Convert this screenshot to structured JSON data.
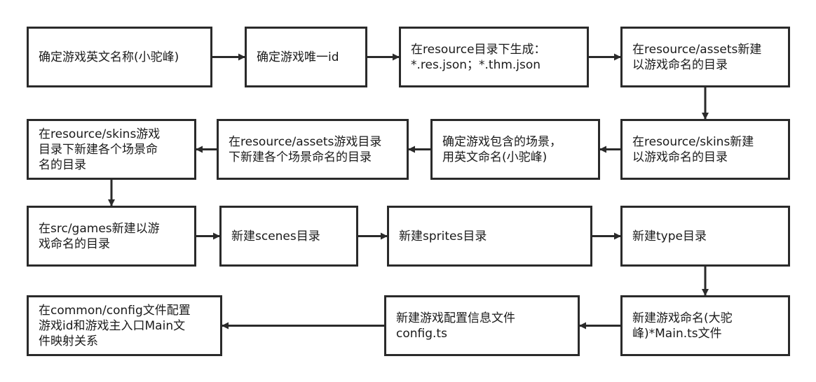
{
  "colors": {
    "stroke": "#2a2a2a",
    "text": "#1a1a1a",
    "background": "#ffffff"
  },
  "nodes": [
    {
      "id": "n1",
      "label": "确定游戏英文名称(小驼峰)"
    },
    {
      "id": "n2",
      "label": "确定游戏唯一id"
    },
    {
      "id": "n3",
      "label": "在resource目录下生成：\n*.res.json；*.thm.json"
    },
    {
      "id": "n4",
      "label": "在resource/assets新建\n以游戏命名的目录"
    },
    {
      "id": "n5",
      "label": "在resource/skins新建\n以游戏命名的目录"
    },
    {
      "id": "n6",
      "label": "确定游戏包含的场景，\n用英文命名(小驼峰)"
    },
    {
      "id": "n7",
      "label": "在resource/assets游戏目录\n下新建各个场景命名的目录"
    },
    {
      "id": "n8",
      "label": "在resource/skins游戏\n目录下新建各个场景命\n名的目录"
    },
    {
      "id": "n9",
      "label": "在src/games新建以游\n戏命名的目录"
    },
    {
      "id": "n10",
      "label": "新建scenes目录"
    },
    {
      "id": "n11",
      "label": "新建sprites目录"
    },
    {
      "id": "n12",
      "label": "新建type目录"
    },
    {
      "id": "n13",
      "label": "新建游戏命名(大驼\n峰)*Main.ts文件"
    },
    {
      "id": "n14",
      "label": "新建游戏配置信息文件\nconfig.ts"
    },
    {
      "id": "n15",
      "label": "在common/config文件配置\n游戏id和游戏主入口Main文\n件映射关系"
    }
  ],
  "edges": [
    {
      "from": "n1",
      "to": "n2"
    },
    {
      "from": "n2",
      "to": "n3"
    },
    {
      "from": "n3",
      "to": "n4"
    },
    {
      "from": "n4",
      "to": "n5"
    },
    {
      "from": "n5",
      "to": "n6"
    },
    {
      "from": "n6",
      "to": "n7"
    },
    {
      "from": "n7",
      "to": "n8"
    },
    {
      "from": "n8",
      "to": "n9"
    },
    {
      "from": "n9",
      "to": "n10"
    },
    {
      "from": "n10",
      "to": "n11"
    },
    {
      "from": "n11",
      "to": "n12"
    },
    {
      "from": "n12",
      "to": "n13"
    },
    {
      "from": "n13",
      "to": "n14"
    },
    {
      "from": "n14",
      "to": "n15"
    }
  ]
}
